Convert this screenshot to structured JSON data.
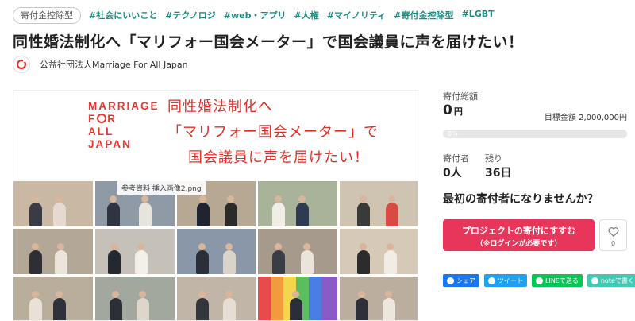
{
  "tagbar": {
    "type_badge": "寄付金控除型",
    "tags": [
      "#社会にいいこと",
      "#テクノロジ",
      "#web・アプリ",
      "#人権",
      "#マイノリティ",
      "#寄付金控除型",
      "#LGBT"
    ]
  },
  "title": "同性婚法制化へ「マリフォー国会メーター」で国会議員に声を届けたい！",
  "org": {
    "name": "公益社団法人Marriage For All Japan"
  },
  "hero": {
    "logo_lines": [
      "MARRIAGE",
      "F",
      "R",
      "ALL",
      "JAPAN"
    ],
    "line1": "同性婚法制化へ",
    "line2": "「マリフォー国会メーター」で",
    "line3": "国会議員に声を届けたい！",
    "tooltip": "参考資料 挿入画像2.png"
  },
  "side": {
    "total_label": "寄付総額",
    "total_value": "0",
    "total_unit": "円",
    "goal": "目標金額 2,000,000円",
    "progress_pct": "0%",
    "donors_label": "寄付者",
    "donors_value": "0人",
    "remain_label": "残り",
    "remain_value": "36日",
    "cta_text": "最初の寄付者になりませんか？",
    "cta_button_l1": "プロジェクトの寄付にすすむ",
    "cta_button_l2": "（※ログインが必要です）",
    "fav_count": "0"
  },
  "share": [
    {
      "label": "シェア",
      "color": "#1877f2"
    },
    {
      "label": "ツイート",
      "color": "#1da1f2"
    },
    {
      "label": "LINEで送る",
      "color": "#06c755"
    },
    {
      "label": "noteで書く",
      "color": "#41c9b4"
    }
  ],
  "colors": {
    "accent": "#e8365a",
    "tag": "#1a8c84",
    "hero_red": "#e32d26"
  }
}
